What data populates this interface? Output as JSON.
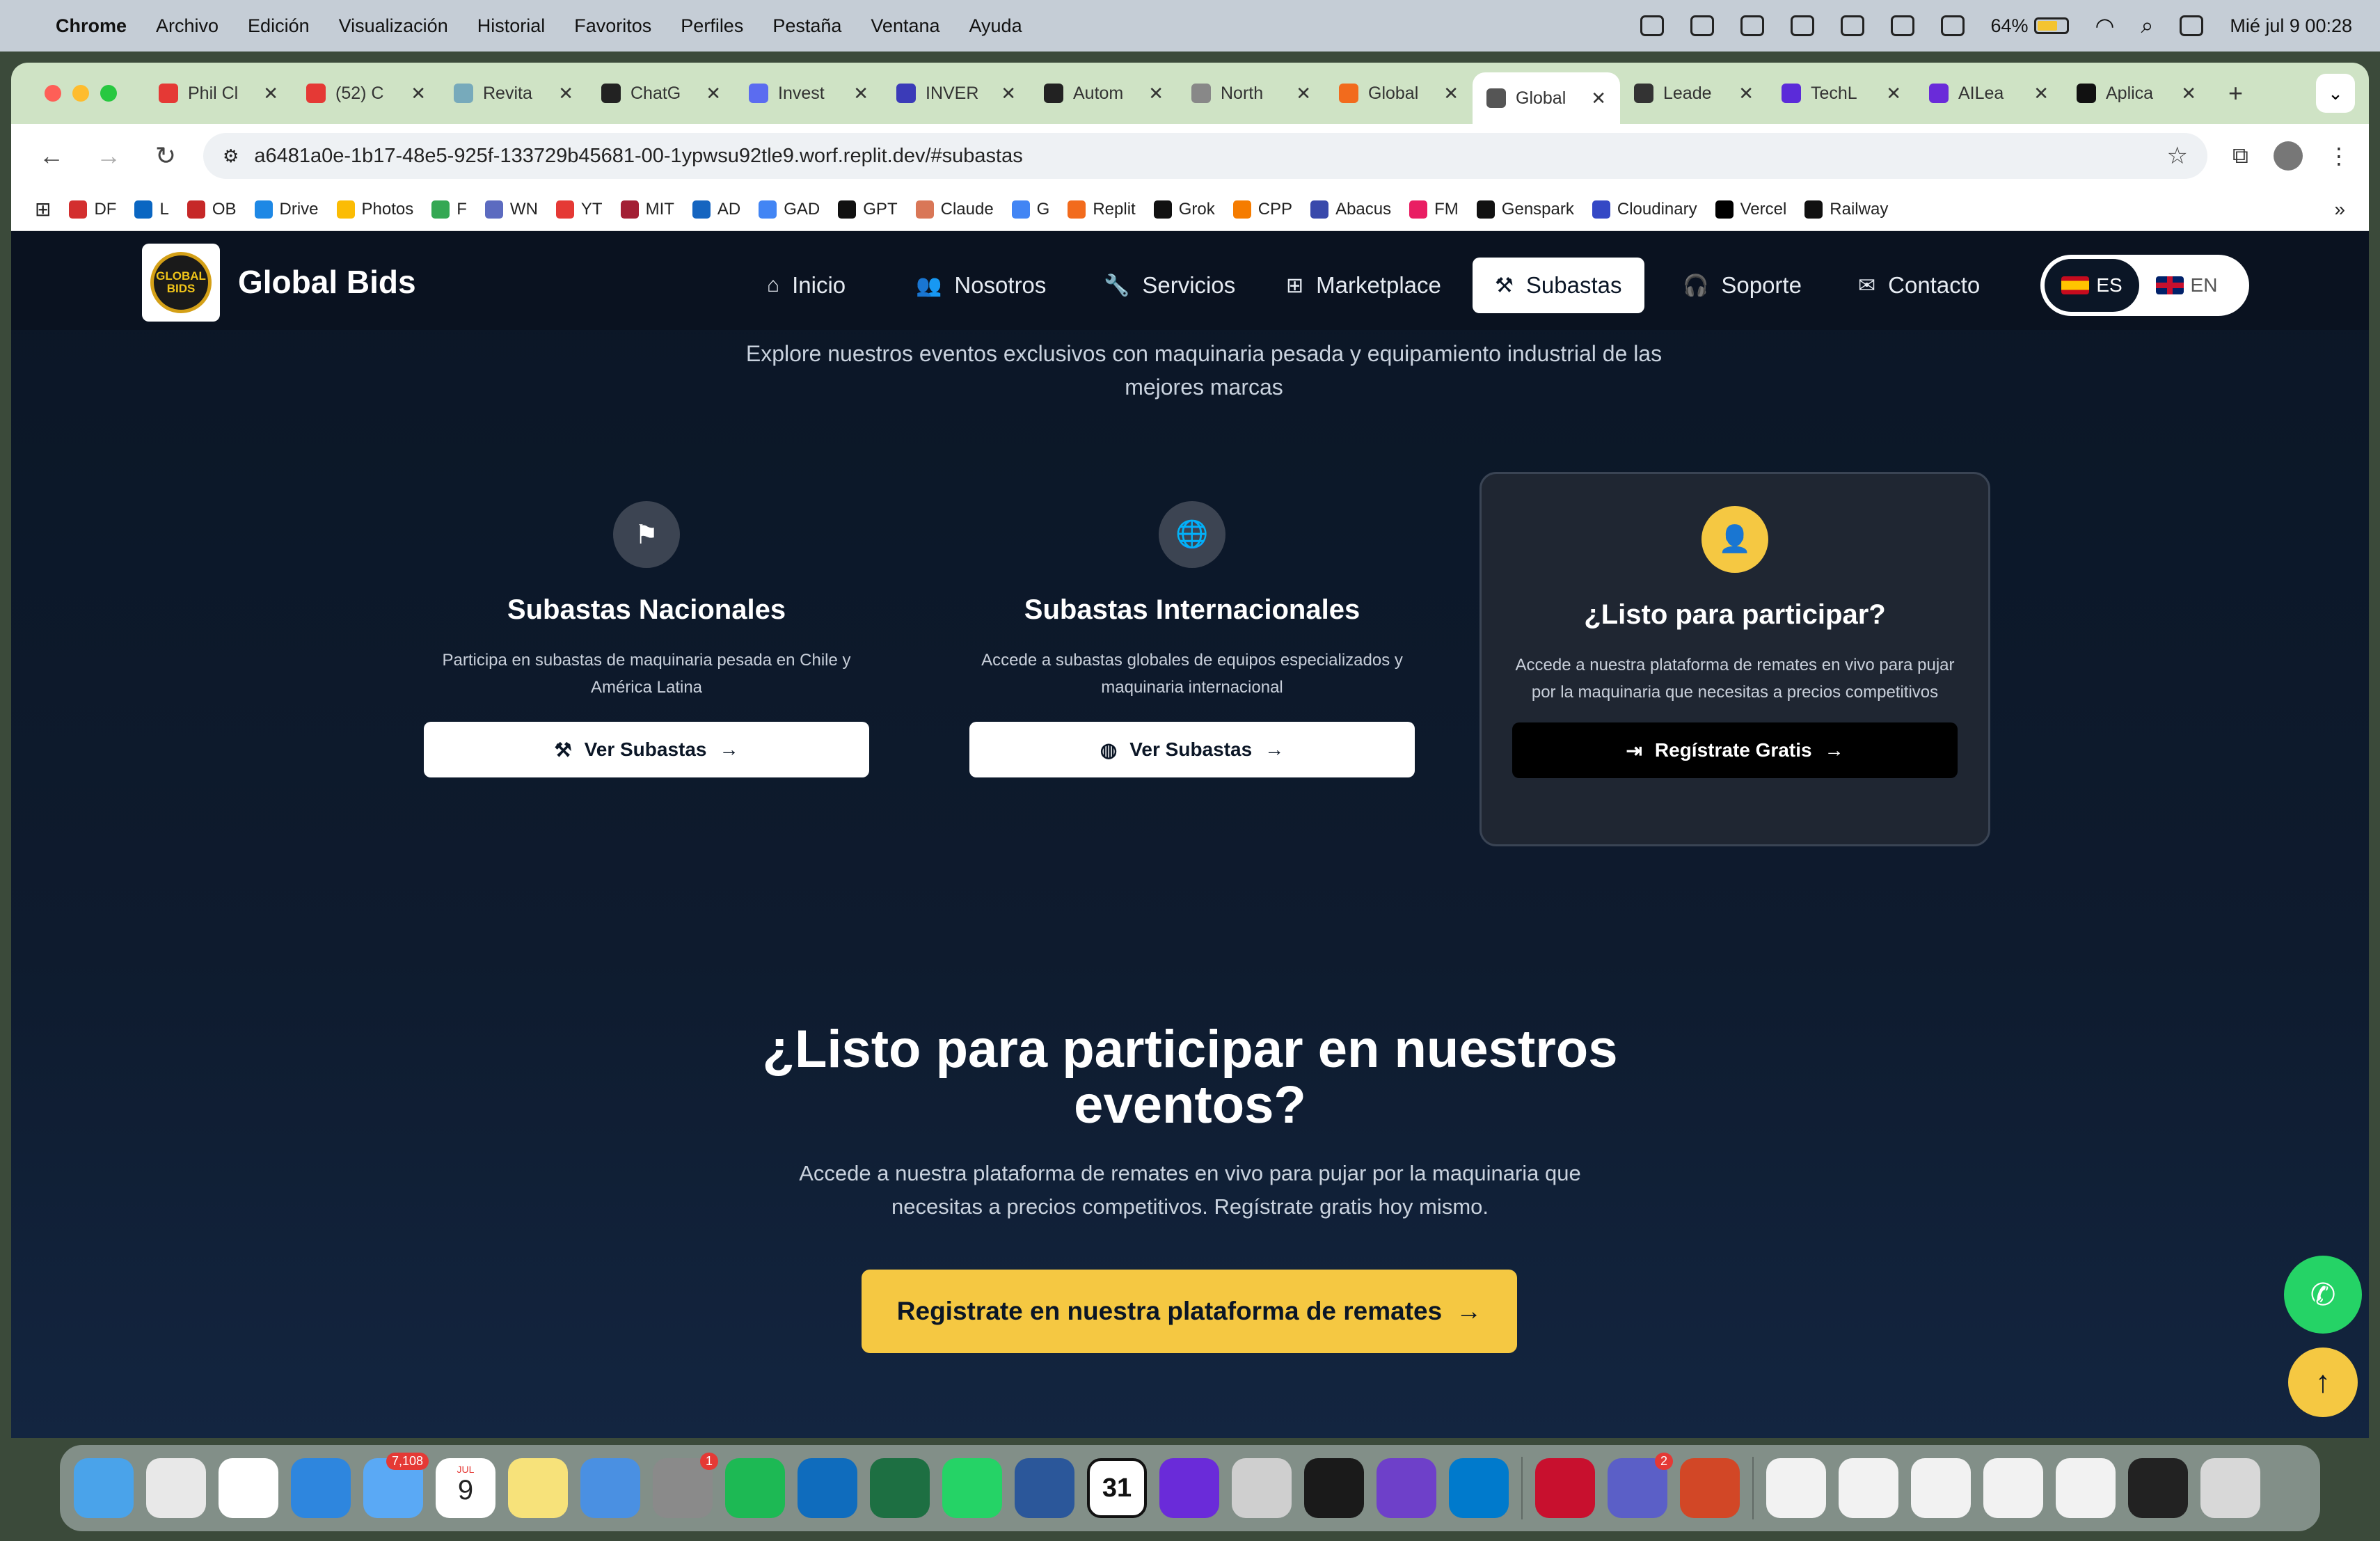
{
  "menubar": {
    "app": "Chrome",
    "items": [
      "Archivo",
      "Edición",
      "Visualización",
      "Historial",
      "Favoritos",
      "Perfiles",
      "Pestaña",
      "Ventana",
      "Ayuda"
    ],
    "battery": "64%",
    "datetime": "Mié jul 9  00:28"
  },
  "tabs": [
    {
      "title": "Phil Cl",
      "color": "#e53935"
    },
    {
      "title": "(52) C",
      "color": "#e53935"
    },
    {
      "title": "Revita",
      "color": "#7ab"
    },
    {
      "title": "ChatG",
      "color": "#222"
    },
    {
      "title": "Invest",
      "color": "#5b6cf0"
    },
    {
      "title": "INVER",
      "color": "#3b3bb8"
    },
    {
      "title": "Autom",
      "color": "#222"
    },
    {
      "title": "North",
      "color": "#888"
    },
    {
      "title": "Global",
      "color": "#f26b1d"
    },
    {
      "title": "Global",
      "color": "#555"
    },
    {
      "title": "Leade",
      "color": "#333"
    },
    {
      "title": "TechL",
      "color": "#5b2bd9"
    },
    {
      "title": "AILea",
      "color": "#6a2bd9"
    },
    {
      "title": "Aplica",
      "color": "#111"
    }
  ],
  "active_tab_index": 9,
  "address": "a6481a0e-1b17-48e5-925f-133729b45681-00-1ypwsu92tle9.worf.replit.dev/#subastas",
  "bookmarks": [
    {
      "label": "DF",
      "color": "#d32f2f"
    },
    {
      "label": "L",
      "color": "#0a66c2"
    },
    {
      "label": "OB",
      "color": "#c62828"
    },
    {
      "label": "Drive",
      "color": "#1e88e5"
    },
    {
      "label": "Photos",
      "color": "#fbbc04"
    },
    {
      "label": "F",
      "color": "#34a853"
    },
    {
      "label": "WN",
      "color": "#5c6bc0"
    },
    {
      "label": "YT",
      "color": "#e53935"
    },
    {
      "label": "MIT",
      "color": "#a31f34"
    },
    {
      "label": "AD",
      "color": "#1565c0"
    },
    {
      "label": "GAD",
      "color": "#4285f4"
    },
    {
      "label": "GPT",
      "color": "#111"
    },
    {
      "label": "Claude",
      "color": "#d97757"
    },
    {
      "label": "G",
      "color": "#4285f4"
    },
    {
      "label": "Replit",
      "color": "#f26b1d"
    },
    {
      "label": "Grok",
      "color": "#111"
    },
    {
      "label": "CPP",
      "color": "#f57c00"
    },
    {
      "label": "Abacus",
      "color": "#3949ab"
    },
    {
      "label": "FM",
      "color": "#e91e63"
    },
    {
      "label": "Genspark",
      "color": "#111"
    },
    {
      "label": "Cloudinary",
      "color": "#3448c5"
    },
    {
      "label": "Vercel",
      "color": "#000"
    },
    {
      "label": "Railway",
      "color": "#111"
    }
  ],
  "site": {
    "logo_text": "GLOBAL BIDS",
    "brand": "Global Bids",
    "nav": [
      {
        "label": "Inicio",
        "icon": "home-icon",
        "glyph": "⌂"
      },
      {
        "label": "Nosotros",
        "icon": "users-icon",
        "glyph": "👥"
      },
      {
        "label": "Servicios",
        "icon": "wrench-icon",
        "glyph": "🔧"
      },
      {
        "label": "Marketplace",
        "icon": "table-icon",
        "glyph": "⊞"
      },
      {
        "label": "Subastas",
        "icon": "gavel-icon",
        "glyph": "⚒"
      },
      {
        "label": "Soporte",
        "icon": "headset-icon",
        "glyph": "🎧"
      },
      {
        "label": "Contacto",
        "icon": "envelope-icon",
        "glyph": "✉"
      }
    ],
    "active_nav": "Subastas",
    "lang": {
      "es": "ES",
      "en": "EN",
      "selected": "ES"
    },
    "intro": "Explore nuestros eventos exclusivos con maquinaria pesada y equipamiento industrial de las mejores marcas",
    "cards": [
      {
        "icon": "flag-icon",
        "title": "Subastas Nacionales",
        "text": "Participa en subastas de maquinaria pesada en Chile y América Latina",
        "button": "Ver Subastas"
      },
      {
        "icon": "globe-icon",
        "title": "Subastas Internacionales",
        "text": "Accede a subastas globales de equipos especializados y maquinaria internacional",
        "button": "Ver Subastas"
      },
      {
        "icon": "user-plus-icon",
        "title": "¿Listo para participar?",
        "text": "Accede a nuestra plataforma de remates en vivo para pujar por la maquinaria que necesitas a precios competitivos",
        "button": "Regístrate Gratis"
      }
    ],
    "cta": {
      "heading": "¿Listo para participar en nuestros eventos?",
      "text": "Accede a nuestra plataforma de remates en vivo para pujar por la maquinaria que necesitas a precios competitivos. Regístrate gratis hoy mismo.",
      "button": "Registrate en nuestra plataforma de remates"
    },
    "colors": {
      "accent": "#f5c842",
      "bg": "#0b1626",
      "whatsapp": "#25d366"
    }
  },
  "dock": {
    "calendar_month": "JUL",
    "calendar_day": "9",
    "mail_badge": "7,108",
    "settings_badge": "1",
    "teams_badge": "2",
    "calendar_app_day": "31",
    "apps": [
      {
        "name": "finder-icon",
        "color": "#4aa3ea"
      },
      {
        "name": "launchpad-icon",
        "color": "#e8e8e8"
      },
      {
        "name": "chrome-icon",
        "color": "#ffffff"
      },
      {
        "name": "safari-icon",
        "color": "#2e86de"
      },
      {
        "name": "mail-icon",
        "color": "#5aa9f5"
      },
      {
        "name": "calendar-icon",
        "color": "#ffffff"
      },
      {
        "name": "notes-icon",
        "color": "#f7e27a"
      },
      {
        "name": "keynote-icon",
        "color": "#4a90e2"
      },
      {
        "name": "system-settings-icon",
        "color": "#8a8a8a"
      },
      {
        "name": "spotify-icon",
        "color": "#1db954"
      },
      {
        "name": "outlook-icon",
        "color": "#0f6cbd"
      },
      {
        "name": "excel-icon",
        "color": "#1d6f42"
      },
      {
        "name": "whatsapp-icon",
        "color": "#25d366"
      },
      {
        "name": "word-icon",
        "color": "#2b579a"
      },
      {
        "name": "calendar-31-icon",
        "color": "#ffffff"
      },
      {
        "name": "circle-app-icon",
        "color": "#6a2bd9"
      },
      {
        "name": "iphone-mirroring-icon",
        "color": "#cfcfcf"
      },
      {
        "name": "tiles-app-icon",
        "color": "#1a1a1a"
      },
      {
        "name": "github-icon",
        "color": "#6e40c9"
      },
      {
        "name": "vscode-icon",
        "color": "#007acc"
      },
      {
        "name": "acrobat-icon",
        "color": "#c8102e"
      },
      {
        "name": "teams-icon",
        "color": "#5b5fc7"
      },
      {
        "name": "powerpoint-icon",
        "color": "#d24726"
      },
      {
        "name": "document-thumb-icon",
        "color": "#f2f2f2"
      },
      {
        "name": "window-thumb-1-icon",
        "color": "#f2f2f2"
      },
      {
        "name": "window-thumb-2-icon",
        "color": "#f2f2f2"
      },
      {
        "name": "window-thumb-3-icon",
        "color": "#f2f2f2"
      },
      {
        "name": "window-thumb-4-icon",
        "color": "#f2f2f2"
      },
      {
        "name": "terminal-thumb-icon",
        "color": "#222222"
      },
      {
        "name": "trash-icon",
        "color": "#d8d8d8"
      }
    ]
  }
}
